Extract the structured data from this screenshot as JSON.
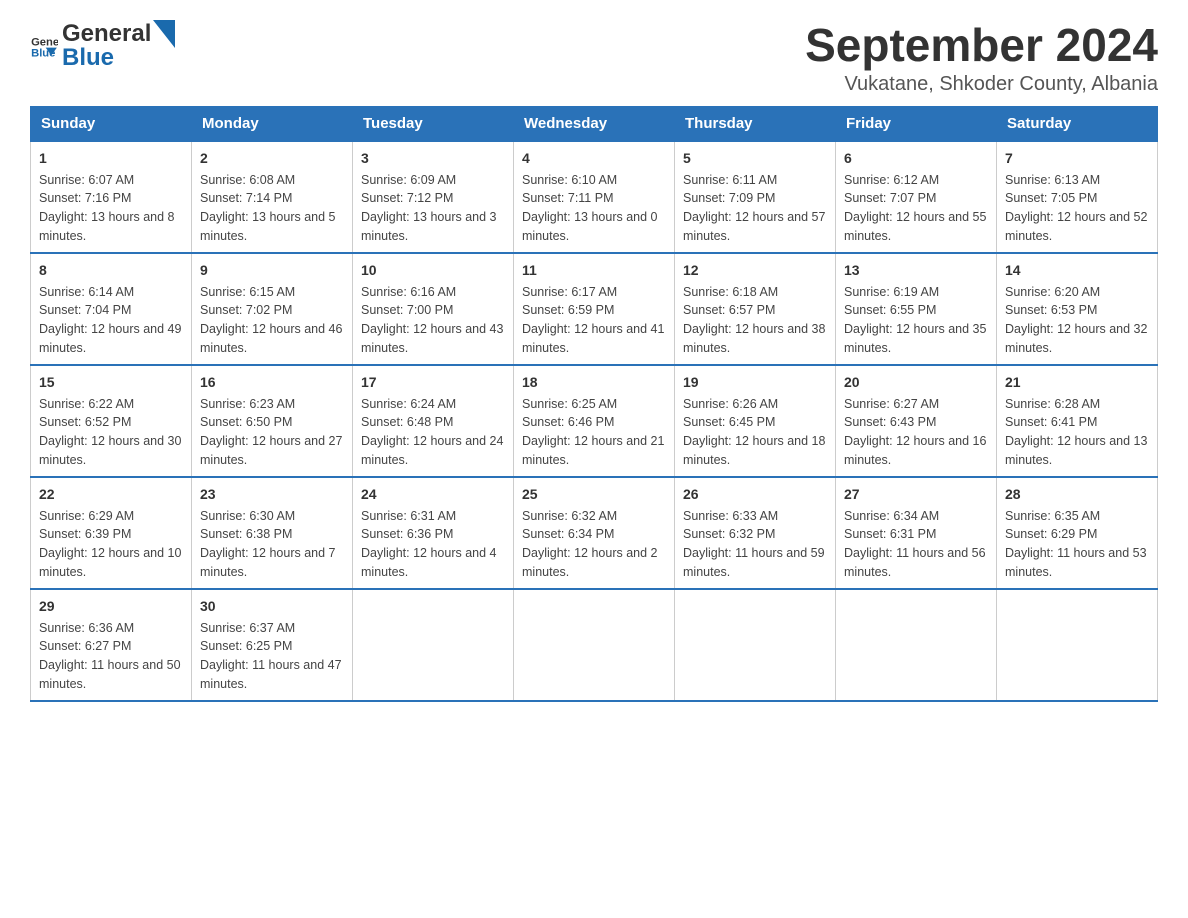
{
  "header": {
    "logo": {
      "general": "General",
      "blue": "Blue"
    },
    "title": "September 2024",
    "subtitle": "Vukatane, Shkoder County, Albania"
  },
  "calendar": {
    "days": [
      "Sunday",
      "Monday",
      "Tuesday",
      "Wednesday",
      "Thursday",
      "Friday",
      "Saturday"
    ],
    "weeks": [
      [
        {
          "num": "1",
          "sunrise": "6:07 AM",
          "sunset": "7:16 PM",
          "daylight": "13 hours and 8 minutes."
        },
        {
          "num": "2",
          "sunrise": "6:08 AM",
          "sunset": "7:14 PM",
          "daylight": "13 hours and 5 minutes."
        },
        {
          "num": "3",
          "sunrise": "6:09 AM",
          "sunset": "7:12 PM",
          "daylight": "13 hours and 3 minutes."
        },
        {
          "num": "4",
          "sunrise": "6:10 AM",
          "sunset": "7:11 PM",
          "daylight": "13 hours and 0 minutes."
        },
        {
          "num": "5",
          "sunrise": "6:11 AM",
          "sunset": "7:09 PM",
          "daylight": "12 hours and 57 minutes."
        },
        {
          "num": "6",
          "sunrise": "6:12 AM",
          "sunset": "7:07 PM",
          "daylight": "12 hours and 55 minutes."
        },
        {
          "num": "7",
          "sunrise": "6:13 AM",
          "sunset": "7:05 PM",
          "daylight": "12 hours and 52 minutes."
        }
      ],
      [
        {
          "num": "8",
          "sunrise": "6:14 AM",
          "sunset": "7:04 PM",
          "daylight": "12 hours and 49 minutes."
        },
        {
          "num": "9",
          "sunrise": "6:15 AM",
          "sunset": "7:02 PM",
          "daylight": "12 hours and 46 minutes."
        },
        {
          "num": "10",
          "sunrise": "6:16 AM",
          "sunset": "7:00 PM",
          "daylight": "12 hours and 43 minutes."
        },
        {
          "num": "11",
          "sunrise": "6:17 AM",
          "sunset": "6:59 PM",
          "daylight": "12 hours and 41 minutes."
        },
        {
          "num": "12",
          "sunrise": "6:18 AM",
          "sunset": "6:57 PM",
          "daylight": "12 hours and 38 minutes."
        },
        {
          "num": "13",
          "sunrise": "6:19 AM",
          "sunset": "6:55 PM",
          "daylight": "12 hours and 35 minutes."
        },
        {
          "num": "14",
          "sunrise": "6:20 AM",
          "sunset": "6:53 PM",
          "daylight": "12 hours and 32 minutes."
        }
      ],
      [
        {
          "num": "15",
          "sunrise": "6:22 AM",
          "sunset": "6:52 PM",
          "daylight": "12 hours and 30 minutes."
        },
        {
          "num": "16",
          "sunrise": "6:23 AM",
          "sunset": "6:50 PM",
          "daylight": "12 hours and 27 minutes."
        },
        {
          "num": "17",
          "sunrise": "6:24 AM",
          "sunset": "6:48 PM",
          "daylight": "12 hours and 24 minutes."
        },
        {
          "num": "18",
          "sunrise": "6:25 AM",
          "sunset": "6:46 PM",
          "daylight": "12 hours and 21 minutes."
        },
        {
          "num": "19",
          "sunrise": "6:26 AM",
          "sunset": "6:45 PM",
          "daylight": "12 hours and 18 minutes."
        },
        {
          "num": "20",
          "sunrise": "6:27 AM",
          "sunset": "6:43 PM",
          "daylight": "12 hours and 16 minutes."
        },
        {
          "num": "21",
          "sunrise": "6:28 AM",
          "sunset": "6:41 PM",
          "daylight": "12 hours and 13 minutes."
        }
      ],
      [
        {
          "num": "22",
          "sunrise": "6:29 AM",
          "sunset": "6:39 PM",
          "daylight": "12 hours and 10 minutes."
        },
        {
          "num": "23",
          "sunrise": "6:30 AM",
          "sunset": "6:38 PM",
          "daylight": "12 hours and 7 minutes."
        },
        {
          "num": "24",
          "sunrise": "6:31 AM",
          "sunset": "6:36 PM",
          "daylight": "12 hours and 4 minutes."
        },
        {
          "num": "25",
          "sunrise": "6:32 AM",
          "sunset": "6:34 PM",
          "daylight": "12 hours and 2 minutes."
        },
        {
          "num": "26",
          "sunrise": "6:33 AM",
          "sunset": "6:32 PM",
          "daylight": "11 hours and 59 minutes."
        },
        {
          "num": "27",
          "sunrise": "6:34 AM",
          "sunset": "6:31 PM",
          "daylight": "11 hours and 56 minutes."
        },
        {
          "num": "28",
          "sunrise": "6:35 AM",
          "sunset": "6:29 PM",
          "daylight": "11 hours and 53 minutes."
        }
      ],
      [
        {
          "num": "29",
          "sunrise": "6:36 AM",
          "sunset": "6:27 PM",
          "daylight": "11 hours and 50 minutes."
        },
        {
          "num": "30",
          "sunrise": "6:37 AM",
          "sunset": "6:25 PM",
          "daylight": "11 hours and 47 minutes."
        },
        null,
        null,
        null,
        null,
        null
      ]
    ]
  }
}
